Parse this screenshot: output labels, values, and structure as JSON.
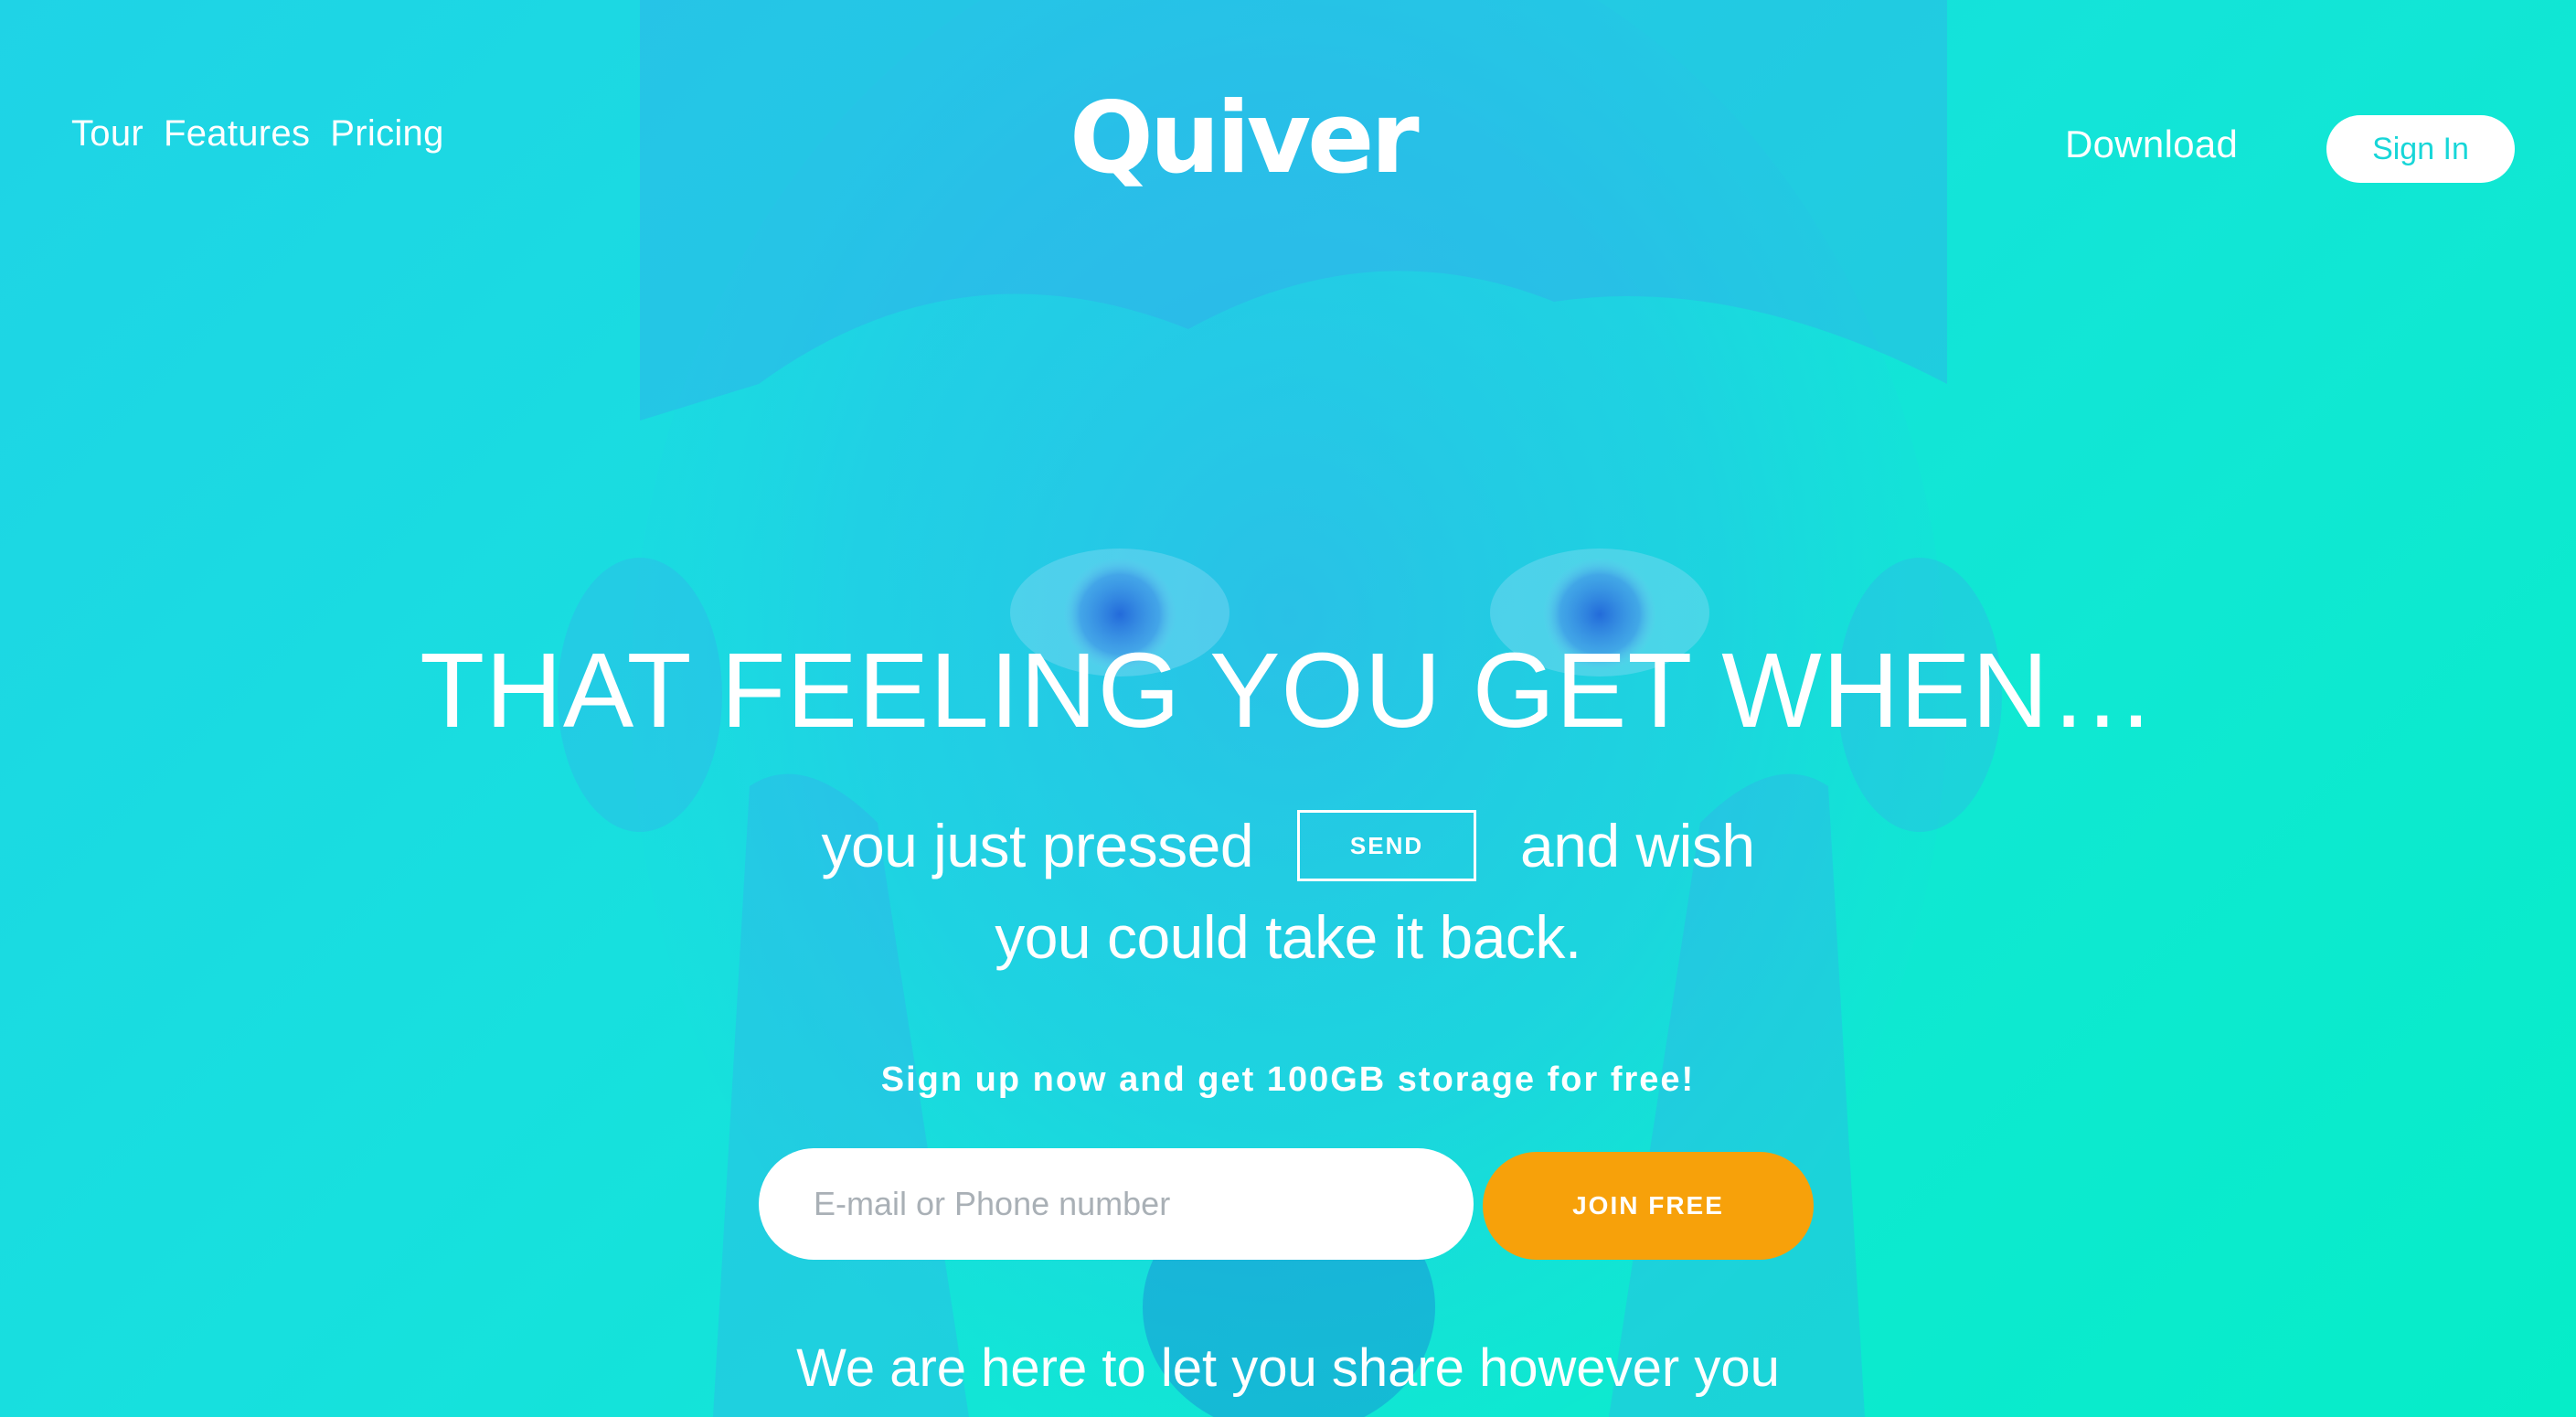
{
  "nav": {
    "left_links": [
      "Tour",
      "Features",
      "Pricing"
    ],
    "logo": "Quiver",
    "download": "Download",
    "sign_in": "Sign In"
  },
  "hero": {
    "headline": "THAT FEELING YOU GET WHEN…",
    "sub_before": "you just pressed",
    "send_label": "SEND",
    "sub_after": "and wish",
    "sub_line2": "you could take it back.",
    "promo": "Sign up now and get 100GB storage for free!",
    "bottom_text": "We are here to let you share however you"
  },
  "signup": {
    "placeholder": "E-mail or Phone number",
    "join_label": "JOIN FREE"
  },
  "colors": {
    "background_start": "#1fd3e6",
    "background_end": "#06edc8",
    "join_button": "#f7a10a",
    "sign_in_text": "#17d6d8"
  }
}
